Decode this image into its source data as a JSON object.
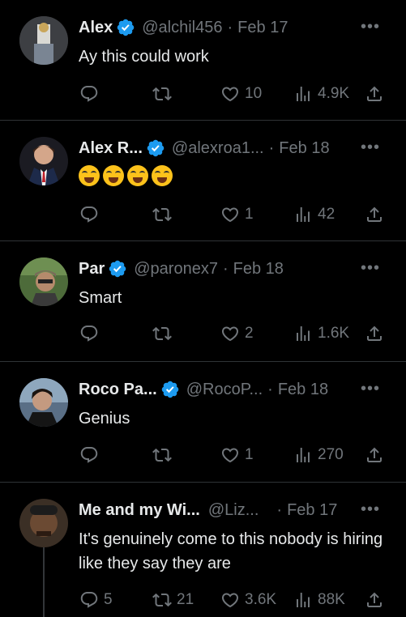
{
  "tweets": [
    {
      "name": "Alex",
      "handle": "@alchil456",
      "date": "Feb 17",
      "text": "Ay this could work",
      "verified": true,
      "replies": "",
      "retweets": "",
      "likes": "10",
      "views": "4.9K"
    },
    {
      "name": "Alex R...",
      "handle": "@alexroa1...",
      "date": "Feb 18",
      "text": "",
      "emoji": "😂😂😂😂",
      "verified": true,
      "replies": "",
      "retweets": "",
      "likes": "1",
      "views": "42"
    },
    {
      "name": "Par",
      "handle": "@paronex7",
      "date": "Feb 18",
      "text": "Smart",
      "verified": true,
      "replies": "",
      "retweets": "",
      "likes": "2",
      "views": "1.6K"
    },
    {
      "name": "Roco Pa...",
      "handle": "@RocoP...",
      "date": "Feb 18",
      "text": "Genius",
      "verified": true,
      "replies": "",
      "retweets": "",
      "likes": "1",
      "views": "270"
    },
    {
      "name": "Me and my Wi...",
      "handle": "@Liz...",
      "date": "Feb 17",
      "text": "It's genuinely come to this nobody is hiring like they say they are",
      "verified": false,
      "replies": "5",
      "retweets": "21",
      "likes": "3.6K",
      "views": "88K"
    }
  ],
  "more_label": "•••",
  "dot": "·",
  "colors": {
    "background": "#000000",
    "text": "#e7e9ea",
    "muted": "#71767b",
    "verified": "#1d9bf0",
    "divider": "#2f3336"
  },
  "icons": [
    "reply-icon",
    "retweet-icon",
    "like-icon",
    "views-icon",
    "share-icon",
    "verified-icon",
    "more-icon"
  ]
}
